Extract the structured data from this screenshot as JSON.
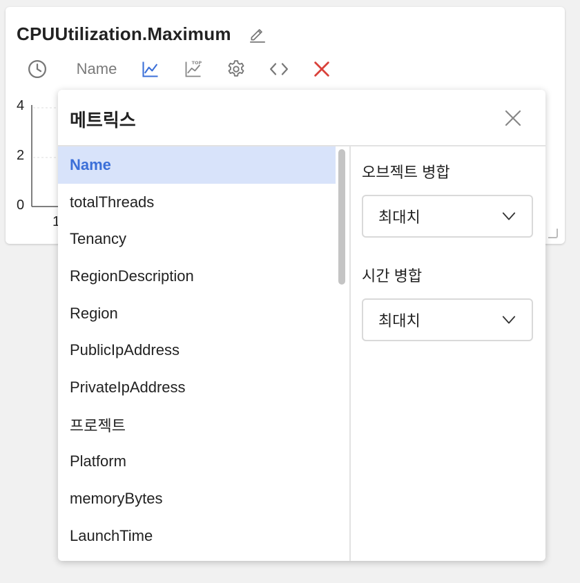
{
  "widget": {
    "title": "CPUUtilization.Maximum",
    "toolbar": {
      "name_label": "Name"
    },
    "chart": {
      "y_ticks": [
        "4",
        "2",
        "0"
      ],
      "x_tick_first": "1"
    }
  },
  "colors": {
    "accent": "#3b6fd8",
    "danger": "#d9413a",
    "selected_bg": "#d8e3fa"
  },
  "metrics_popup": {
    "title": "메트릭스",
    "items": [
      {
        "label": "Name"
      },
      {
        "label": "totalThreads"
      },
      {
        "label": "Tenancy"
      },
      {
        "label": "RegionDescription"
      },
      {
        "label": "Region"
      },
      {
        "label": "PublicIpAddress"
      },
      {
        "label": "PrivateIpAddress"
      },
      {
        "label": "프로젝트"
      },
      {
        "label": "Platform"
      },
      {
        "label": "memoryBytes"
      },
      {
        "label": "LaunchTime"
      }
    ],
    "object_merge": {
      "label": "오브젝트 병합",
      "value": "최대치"
    },
    "time_merge": {
      "label": "시간 병합",
      "value": "최대치"
    }
  }
}
